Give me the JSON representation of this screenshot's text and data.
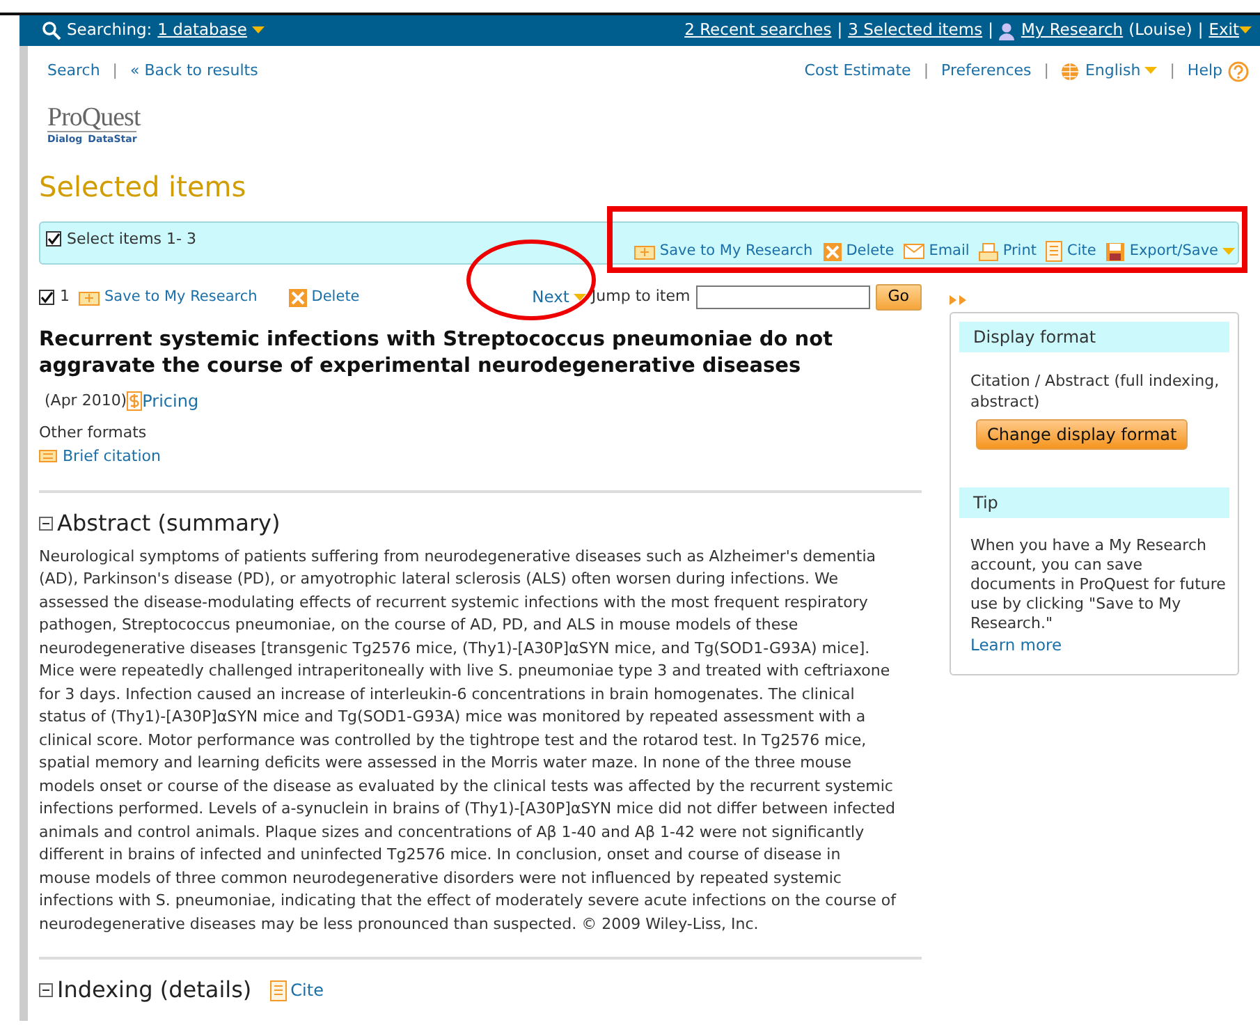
{
  "top_bar": {
    "search_label": "Searching:",
    "database_link": "1 database",
    "links": [
      "2 Recent searches",
      "3 Selected items"
    ],
    "separators": [
      "|",
      "|",
      "|"
    ],
    "my_research": "My Research",
    "user": "(Louise)",
    "exit": "Exit"
  },
  "nav": {
    "left_separators": [
      "|"
    ],
    "right_separators": [
      "|",
      "|",
      "|"
    ],
    "left": [
      "Search",
      "« Back to results"
    ],
    "right": [
      {
        "kind": "link",
        "text": "Cost Estimate"
      },
      {
        "kind": "link",
        "text": "Preferences"
      },
      {
        "kind": "language",
        "text": "English"
      },
      {
        "kind": "help",
        "text": "Help"
      }
    ]
  },
  "logo": {
    "name": "ProQuest",
    "sub_left": "Dialog",
    "sub_right": "DataStar"
  },
  "page_title": "Selected items",
  "select_bar": {
    "checked": true,
    "label": "Select items 1- 3",
    "actions": [
      {
        "kind": "save",
        "text": "Save to My Research"
      },
      {
        "kind": "delete",
        "text": "Delete"
      },
      {
        "kind": "email",
        "text": "Email"
      },
      {
        "kind": "print",
        "text": "Print"
      },
      {
        "kind": "cite",
        "text": "Cite"
      },
      {
        "kind": "export",
        "text": "Export/Save"
      }
    ]
  },
  "item": {
    "checked": true,
    "number": "1",
    "actions": [
      {
        "kind": "save",
        "text": "Save to My Research"
      },
      {
        "kind": "delete",
        "text": "Delete"
      }
    ],
    "next": "Next",
    "jump_label": "Jump to item",
    "go": "Go",
    "title": "Recurrent systemic infections with Streptococcus pneumoniae do not aggravate the course of experimental neurodegenerative diseases",
    "date": "(Apr 2010)",
    "pricing": "Pricing",
    "other_formats": "Other formats",
    "brief_citation": "Brief citation"
  },
  "abstract": {
    "heading": "Abstract (summary)",
    "expanded": true,
    "text": "Neurological symptoms of patients suffering from neurodegenerative diseases such as Alzheimer's dementia (AD), Parkinson's disease (PD), or amyotrophic lateral sclerosis (ALS) often worsen during infections. We assessed the disease-modulating effects of recurrent systemic infections with the most frequent respiratory pathogen, Streptococcus pneumoniae, on the course of AD, PD, and ALS in mouse models of these neurodegenerative diseases [transgenic Tg2576 mice, (Thy1)-[A30P]αSYN mice, and Tg(SOD1-G93A) mice]. Mice were repeatedly challenged intraperitoneally with live S. pneumoniae type 3 and treated with ceftriaxone for 3 days. Infection caused an increase of interleukin-6 concentrations in brain homogenates. The clinical status of (Thy1)-[A30P]αSYN mice and Tg(SOD1-G93A) mice was monitored by repeated assessment with a clinical score. Motor performance was controlled by the tightrope test and the rotarod test. In Tg2576 mice, spatial memory and learning deficits were assessed in the Morris water maze. In none of the three mouse models onset or course of the disease as evaluated by the clinical tests was affected by the recurrent systemic infections performed. Levels of a-synuclein in brains of (Thy1)-[A30P]αSYN mice did not differ between infected animals and control animals. Plaque sizes and concentrations of Aβ 1-40 and Aβ 1-42 were not significantly different in brains of infected and uninfected Tg2576 mice. In conclusion, onset and course of disease in mouse models of three common neurodegenerative disorders were not influenced by repeated systemic infections with S. pneumoniae, indicating that the effect of moderately severe acute infections on the course of neurodegenerative diseases may be less pronounced than suspected. © 2009 Wiley-Liss, Inc."
  },
  "indexing": {
    "heading": "Indexing (details)",
    "expanded": true,
    "cite": "Cite"
  },
  "sidebar": {
    "display_format": {
      "heading": "Display format",
      "text": "Citation / Abstract (full indexing, abstract)",
      "button": "Change display format"
    },
    "tip": {
      "heading": "Tip",
      "text": "When you have a My Research account, you can save documents in ProQuest for future use by clicking \"Save to My Research.\"",
      "link": "Learn more"
    }
  },
  "annotations": [
    {
      "kind": "rectangle"
    },
    {
      "kind": "ellipse"
    }
  ]
}
